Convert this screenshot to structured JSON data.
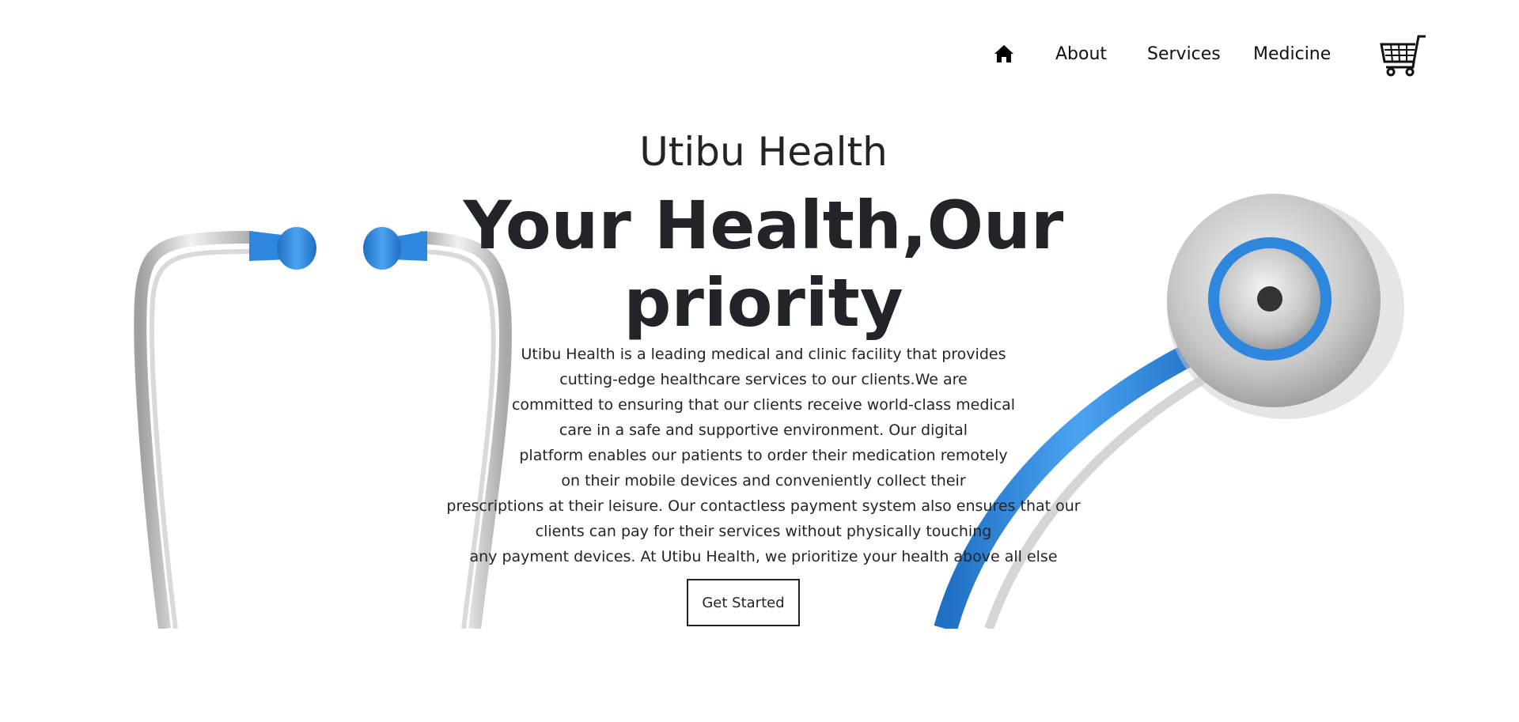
{
  "nav": {
    "home_icon": "home-icon",
    "items": [
      {
        "label": "About"
      },
      {
        "label": "Services"
      },
      {
        "label": "Medicine"
      }
    ],
    "cart_icon": "shopping-cart-icon"
  },
  "hero": {
    "brand": "Utibu Health",
    "headline_line1": "Your Health,Our",
    "headline_line2": "priority",
    "description_lines": [
      "Utibu Health is a leading medical and clinic facility that provides",
      "cutting-edge healthcare services to our clients.We are",
      "committed to ensuring that our clients receive world-class medical",
      "care in a safe and supportive environment. Our digital",
      "platform enables our patients to order their medication remotely",
      "on their mobile devices and conveniently collect their",
      "prescriptions at their leisure. Our contactless payment system also ensures that our",
      "clients can pay for their services without physically touching",
      "any payment devices. At Utibu Health, we prioritize your health above all else"
    ],
    "cta_label": "Get Started",
    "illustration": "stethoscope-illustration"
  },
  "colors": {
    "text": "#212529",
    "stethoscope_blue": "#2f86dd",
    "tube_gray": "#b8b8b8"
  }
}
